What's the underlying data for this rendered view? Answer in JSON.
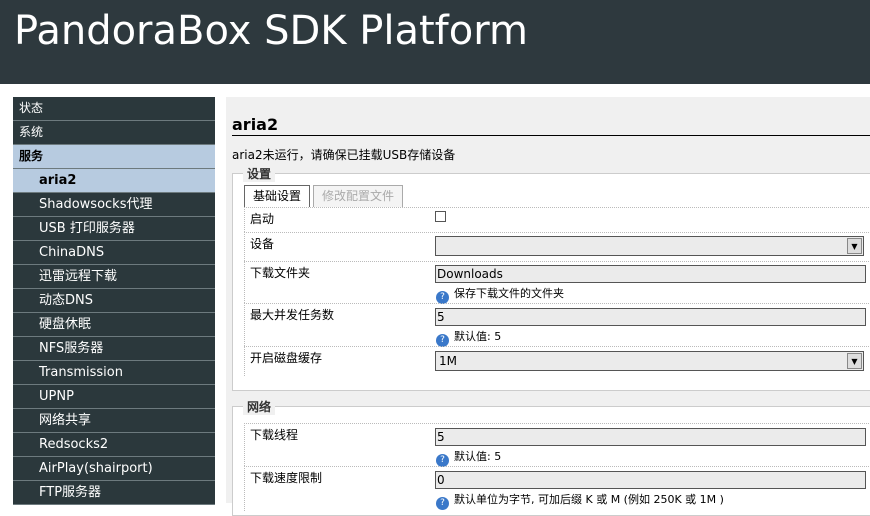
{
  "header": {
    "title": "PandoraBox SDK Platform"
  },
  "sidebar": {
    "items": [
      {
        "label": "状态",
        "level": 0,
        "active": false
      },
      {
        "label": "系统",
        "level": 0,
        "active": false
      },
      {
        "label": "服务",
        "level": 0,
        "active": true
      },
      {
        "label": "aria2",
        "level": 1,
        "active": true
      },
      {
        "label": "Shadowsocks代理",
        "level": 1
      },
      {
        "label": "USB 打印服务器",
        "level": 1
      },
      {
        "label": "ChinaDNS",
        "level": 1
      },
      {
        "label": "迅雷远程下载",
        "level": 1
      },
      {
        "label": "动态DNS",
        "level": 1
      },
      {
        "label": "硬盘休眠",
        "level": 1
      },
      {
        "label": "NFS服务器",
        "level": 1
      },
      {
        "label": "Transmission",
        "level": 1
      },
      {
        "label": "UPNP",
        "level": 1
      },
      {
        "label": "网络共享",
        "level": 1
      },
      {
        "label": "Redsocks2",
        "level": 1
      },
      {
        "label": "AirPlay(shairport)",
        "level": 1
      },
      {
        "label": "FTP服务器",
        "level": 1
      }
    ]
  },
  "main": {
    "title": "aria2",
    "message": "aria2未运行，请确保已挂载USB存储设备",
    "settings": {
      "legend": "设置",
      "tabs": [
        "基础设置",
        "修改配置文件"
      ],
      "enable_label": "启动",
      "device_label": "设备",
      "device_value": "",
      "folder_label": "下载文件夹",
      "folder_value": "Downloads",
      "folder_hint": "保存下载文件的文件夹",
      "maxtasks_label": "最大并发任务数",
      "maxtasks_value": "5",
      "maxtasks_hint": "默认值: 5",
      "cache_label": "开启磁盘缓存",
      "cache_value": "1M"
    },
    "network": {
      "legend": "网络",
      "threads_label": "下载线程",
      "threads_value": "5",
      "threads_hint": "默认值: 5",
      "speed_label": "下载速度限制",
      "speed_value": "0",
      "speed_hint": "默认单位为字节, 可加后缀 K 或 M (例如 250K 或 1M )"
    }
  }
}
